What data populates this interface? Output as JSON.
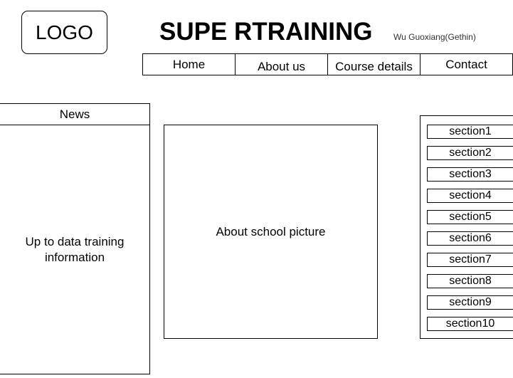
{
  "header": {
    "logo": "LOGO",
    "title": "SUPE RTRAINING",
    "author": "Wu Guoxiang(Gethin)"
  },
  "nav": {
    "home": "Home",
    "about": "About us",
    "course": "Course details",
    "contact": "Contact"
  },
  "news": {
    "header": "News",
    "body": "Up to data training information"
  },
  "main": {
    "picture": "About school picture"
  },
  "sections": [
    "section1",
    "section2",
    "section3",
    "section4",
    "section5",
    "section6",
    "section7",
    "section8",
    "section9",
    "section10"
  ]
}
